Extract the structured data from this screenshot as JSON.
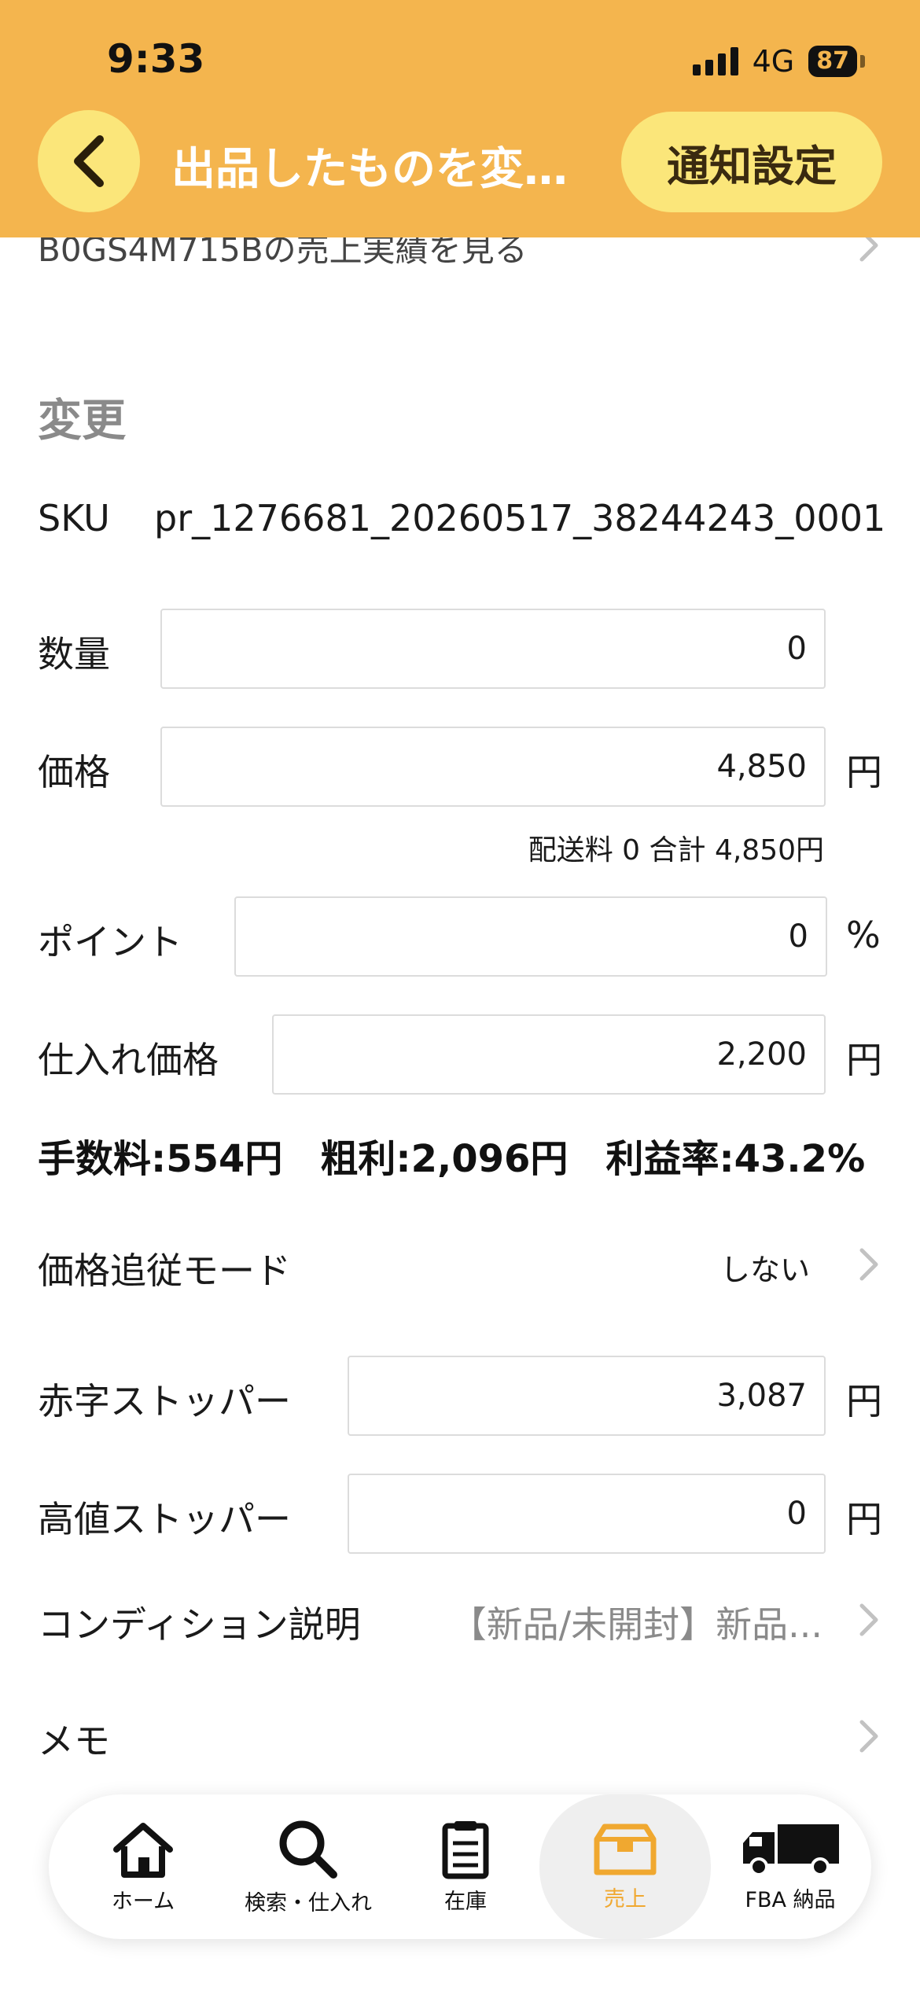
{
  "status_bar": {
    "time": "9:33",
    "network": "4G",
    "battery": "87"
  },
  "nav": {
    "title": "出品したものを変…",
    "notify_button": "通知設定"
  },
  "sales_link": "B0GS4M715Bの売上実績を見る",
  "section_title": "変更",
  "sku": {
    "label": "SKU",
    "value": "pr_1276681_20260517_38244243_0001"
  },
  "quantity": {
    "label": "数量",
    "value": "0"
  },
  "price": {
    "label": "価格",
    "value": "4,850",
    "unit": "円"
  },
  "shipping_info": "配送料 0 合計 4,850円",
  "point": {
    "label": "ポイント",
    "value": "0",
    "unit": "%"
  },
  "purchase_price": {
    "label": "仕入れ価格",
    "value": "2,200",
    "unit": "円"
  },
  "summary": {
    "fee": "手数料:554円",
    "gross_profit": "粗利:2,096円",
    "margin": "利益率:43.2%"
  },
  "price_tracking": {
    "label": "価格追従モード",
    "value": "しない"
  },
  "deficit_stopper": {
    "label": "赤字ストッパー",
    "value": "3,087",
    "unit": "円"
  },
  "high_stopper": {
    "label": "高値ストッパー",
    "value": "0",
    "unit": "円"
  },
  "condition": {
    "label": "コンディション説明",
    "value": "【新品/未開封】新品..."
  },
  "memo": {
    "label": "メモ"
  },
  "tabs": [
    {
      "label": "ホーム",
      "icon": "home-icon"
    },
    {
      "label": "検索・仕入れ",
      "icon": "search-icon"
    },
    {
      "label": "在庫",
      "icon": "clipboard-icon"
    },
    {
      "label": "売上",
      "icon": "box-icon",
      "active": true
    },
    {
      "label": "FBA 納品",
      "icon": "truck-icon"
    }
  ],
  "colors": {
    "header": "#f4b54e",
    "button": "#fbe67a",
    "active_tab": "#f0a830"
  }
}
